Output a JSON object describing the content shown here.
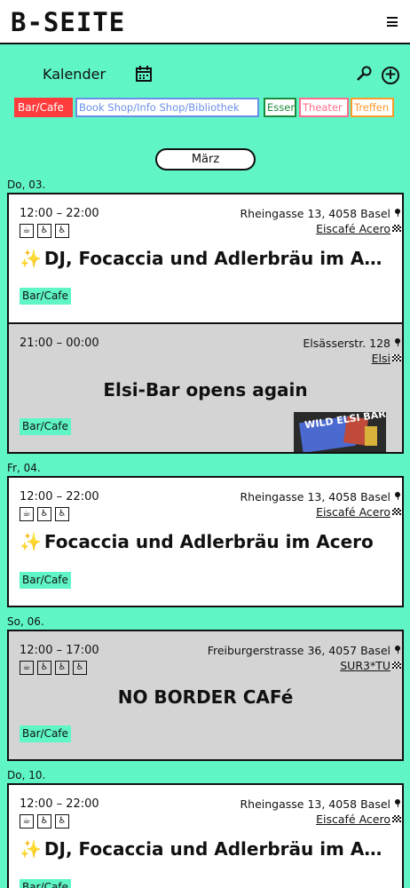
{
  "header": {
    "logo": "B-SEITE",
    "menu_icon": "hamburger-icon"
  },
  "calendar": {
    "title": "Kalender",
    "icon": "calendar-icon",
    "search_icon": "search-icon",
    "add_icon": "plus-circle-icon",
    "add_glyph": "+"
  },
  "filters": [
    {
      "label": "Bar/Cafe",
      "color": "#ff3c3c",
      "active": true
    },
    {
      "label": "Book Shop/Info Shop/Bibliothek",
      "color": "#6a8fe8"
    },
    {
      "label": "Essen",
      "color": "#1d8a3a"
    },
    {
      "label": "Theater",
      "color": "#ff6d8e"
    },
    {
      "label": "Treffen",
      "color": "#ff9a2b"
    }
  ],
  "month": "März",
  "days": [
    {
      "label": "Do, 03.",
      "events": [
        {
          "time": "12:00 – 22:00",
          "address": "Rheingasse 13, 4058 Basel",
          "venue": "Eiscafé Acero",
          "icons": [
            "☕",
            "♿",
            "♿"
          ],
          "title": "DJ, Focaccia und Adlerbräu im Acero",
          "star": "✨",
          "tag": "Bar/Cafe"
        },
        {
          "time": "21:00 – 00:00",
          "address": "Elsässerstr. 128",
          "venue": "Elsi",
          "title": "Elsi-Bar opens again",
          "tag": "Bar/Cafe",
          "image_text": "WILD ELSI BAR"
        }
      ]
    },
    {
      "label": "Fr, 04.",
      "events": [
        {
          "time": "12:00 – 22:00",
          "address": "Rheingasse 13, 4058 Basel",
          "venue": "Eiscafé Acero",
          "icons": [
            "☕",
            "♿",
            "♿"
          ],
          "title": "Focaccia und Adlerbräu im Acero",
          "star": "✨",
          "tag": "Bar/Cafe"
        }
      ]
    },
    {
      "label": "So, 06.",
      "events": [
        {
          "time": "12:00 – 17:00",
          "address": "Freiburgerstrasse 36, 4057 Basel",
          "venue": "SUR3*TU",
          "icons": [
            "☕",
            "♿",
            "♿",
            "♿"
          ],
          "title": "NO BORDER CAFé",
          "tag": "Bar/Cafe"
        }
      ]
    },
    {
      "label": "Do, 10.",
      "events": [
        {
          "time": "12:00 – 22:00",
          "address": "Rheingasse 13, 4058 Basel",
          "venue": "Eiscafé Acero",
          "icons": [
            "☕",
            "♿",
            "♿"
          ],
          "title": "DJ, Focaccia und Adlerbräu im Acero",
          "star": "✨",
          "tag": "Bar/Cafe"
        }
      ]
    }
  ]
}
